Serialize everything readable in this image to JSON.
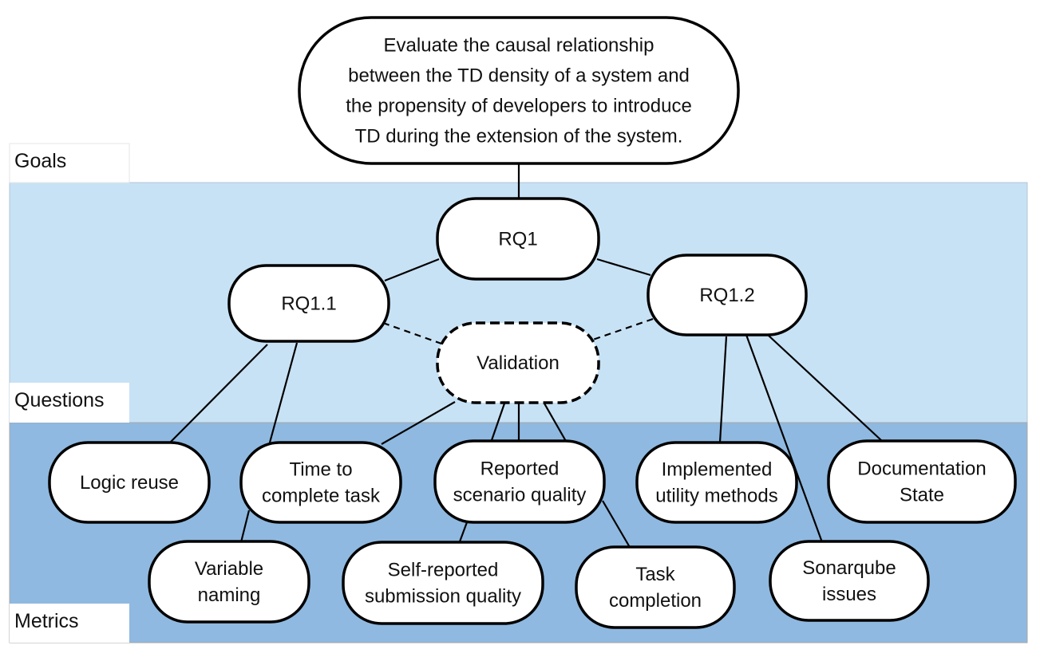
{
  "colors": {
    "questions_band": "#c8e2f5",
    "metrics_band": "#8fb9e0",
    "node_fill": "#ffffff",
    "node_stroke": "#000000"
  },
  "layers": {
    "goals": "Goals",
    "questions": "Questions",
    "metrics": "Metrics"
  },
  "goal": {
    "lines": [
      "Evaluate the causal relationship",
      "between the TD density of a system and",
      "the propensity of developers to introduce",
      "TD during the extension of the system."
    ]
  },
  "questions": {
    "rq1": {
      "lines": [
        "RQ1"
      ]
    },
    "rq1_1": {
      "lines": [
        "RQ1.1"
      ]
    },
    "rq1_2": {
      "lines": [
        "RQ1.2"
      ]
    },
    "validation": {
      "lines": [
        "Validation"
      ]
    }
  },
  "metrics": {
    "logic_reuse": {
      "lines": [
        "Logic reuse"
      ]
    },
    "time_to_complete": {
      "lines": [
        "Time to",
        "complete task"
      ]
    },
    "reported_scenario_quality": {
      "lines": [
        "Reported",
        "scenario quality"
      ]
    },
    "implemented_utility_methods": {
      "lines": [
        "Implemented",
        "utility methods"
      ]
    },
    "documentation_state": {
      "lines": [
        "Documentation",
        "State"
      ]
    },
    "variable_naming": {
      "lines": [
        "Variable",
        "naming"
      ]
    },
    "self_reported_quality": {
      "lines": [
        "Self-reported",
        "submission quality"
      ]
    },
    "task_completion": {
      "lines": [
        "Task",
        "completion"
      ]
    },
    "sonarqube_issues": {
      "lines": [
        "Sonarqube",
        "issues"
      ]
    }
  }
}
